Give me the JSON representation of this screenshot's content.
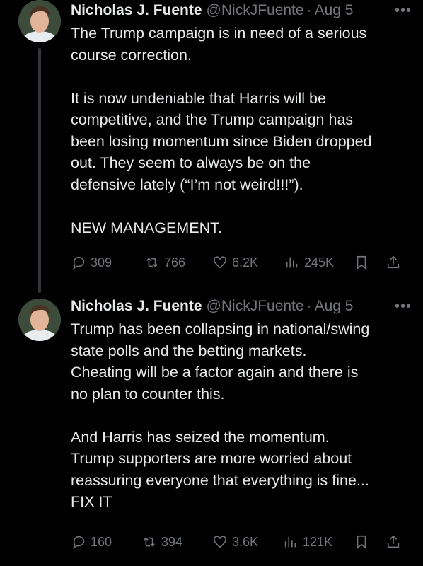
{
  "tweets": [
    {
      "author": "Nicholas J. Fuente",
      "handle": "@NickJFuente",
      "separator": "·",
      "date": "Aug 5",
      "more": "•••",
      "text": "The Trump campaign is in need of a serious\ncourse correction.\n\nIt is now undeniable that Harris will be\ncompetitive, and the Trump campaign has\nbeen losing momentum since Biden dropped\nout. They seem to always be on the\ndefensive lately (“I’m not weird!!!”).\n\nNEW MANAGEMENT.",
      "replies": "309",
      "reposts": "766",
      "likes": "6.2K",
      "views": "245K"
    },
    {
      "author": "Nicholas J. Fuente",
      "handle": "@NickJFuente",
      "separator": "·",
      "date": "Aug 5",
      "more": "•••",
      "text": "Trump has been collapsing in national/swing\nstate polls and the betting markets.\nCheating will be a factor again and there is\nno plan to counter this.\n\nAnd Harris has seized the momentum.\nTrump supporters are more worried about\nreassuring everyone that everything is fine...\nFIX IT",
      "replies": "160",
      "reposts": "394",
      "likes": "3.6K",
      "views": "121K"
    }
  ],
  "icons": [
    "reply-icon",
    "repost-icon",
    "like-icon",
    "views-icon",
    "bookmark-icon",
    "share-icon"
  ],
  "colors": {
    "background": "#000000",
    "text": "#e7e9ea",
    "muted": "#71767b",
    "thread_line": "#333639"
  }
}
